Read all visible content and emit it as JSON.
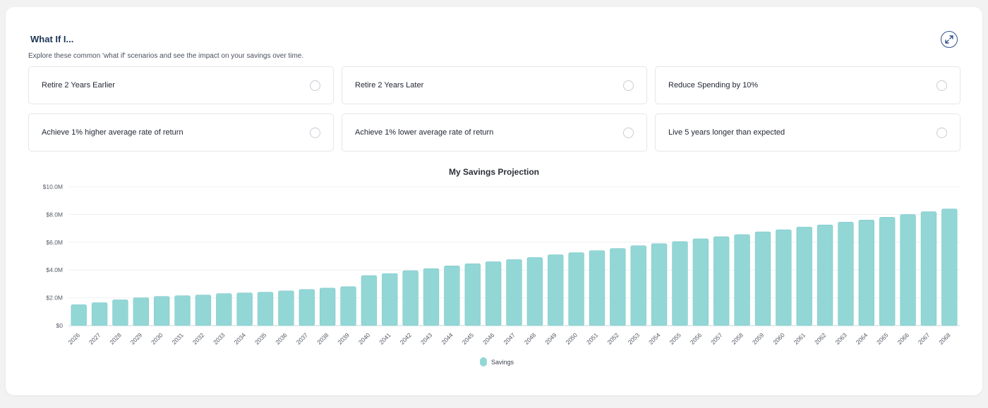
{
  "header": {
    "title": "What If I...",
    "subtitle": "Explore these common 'what if' scenarios and see the impact on your savings over time."
  },
  "scenarios": [
    {
      "label": "Retire 2 Years Earlier"
    },
    {
      "label": "Retire 2 Years Later"
    },
    {
      "label": "Reduce Spending by 10%"
    },
    {
      "label": "Achieve 1% higher average rate of return"
    },
    {
      "label": "Achieve 1% lower average rate of return"
    },
    {
      "label": "Live 5 years longer than expected"
    }
  ],
  "chart_data": {
    "type": "bar",
    "title": "My Savings Projection",
    "categories": [
      "2026",
      "2027",
      "2028",
      "2029",
      "2030",
      "2031",
      "2032",
      "2033",
      "2034",
      "2035",
      "2036",
      "2037",
      "2038",
      "2039",
      "2040",
      "2041",
      "2042",
      "2043",
      "2044",
      "2045",
      "2046",
      "2047",
      "2048",
      "2049",
      "2050",
      "2051",
      "2052",
      "2053",
      "2054",
      "2055",
      "2056",
      "2057",
      "2058",
      "2059",
      "2060",
      "2061",
      "2062",
      "2063",
      "2064",
      "2065",
      "2066",
      "2067",
      "2068"
    ],
    "series": [
      {
        "name": "Savings",
        "values": [
          1.5,
          1.65,
          1.85,
          2.0,
          2.1,
          2.15,
          2.2,
          2.3,
          2.35,
          2.4,
          2.5,
          2.6,
          2.7,
          2.8,
          3.6,
          3.75,
          3.95,
          4.1,
          4.3,
          4.45,
          4.6,
          4.75,
          4.9,
          5.1,
          5.25,
          5.4,
          5.55,
          5.75,
          5.9,
          6.05,
          6.25,
          6.4,
          6.55,
          6.75,
          6.9,
          7.1,
          7.25,
          7.45,
          7.6,
          7.8,
          8.0,
          8.2,
          8.4
        ]
      }
    ],
    "ylim": [
      0,
      10
    ],
    "yticks": [
      "$0",
      "$2.0M",
      "$4.0M",
      "$6.0M",
      "$8.0M",
      "$10.0M"
    ],
    "color": "#93d6d6",
    "grid": true,
    "legend": "bottom-center"
  },
  "icons": {
    "expand": "expand-icon"
  }
}
